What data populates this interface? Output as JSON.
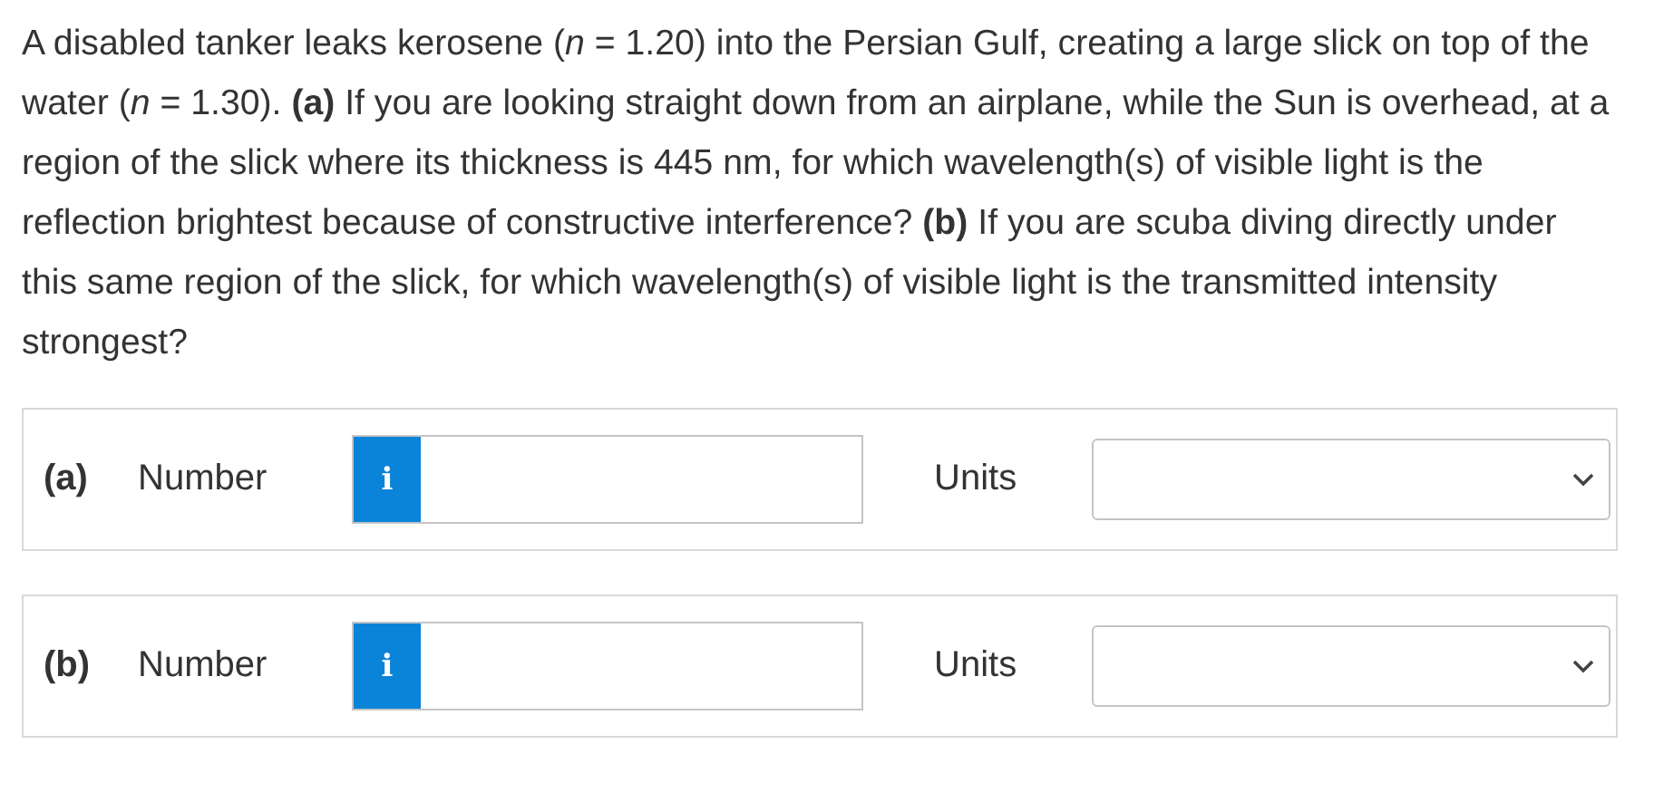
{
  "question": "A disabled tanker leaks kerosene (*n* = 1.20) into the Persian Gulf, creating a large slick on top of the water (*n* = 1.30). **(a)** If you are looking straight down from an airplane, while the Sun is overhead, at a region of the slick where its thickness is 445 nm, for which wavelength(s) of visible light is the reflection brightest because of constructive interference? **(b)** If you are scuba diving directly under this same region of the slick, for which wavelength(s) of visible light is the transmitted intensity strongest?",
  "answers": [
    {
      "part": "(a)",
      "label": "Number",
      "info": "i",
      "units_label": "Units"
    },
    {
      "part": "(b)",
      "label": "Number",
      "info": "i",
      "units_label": "Units"
    }
  ]
}
